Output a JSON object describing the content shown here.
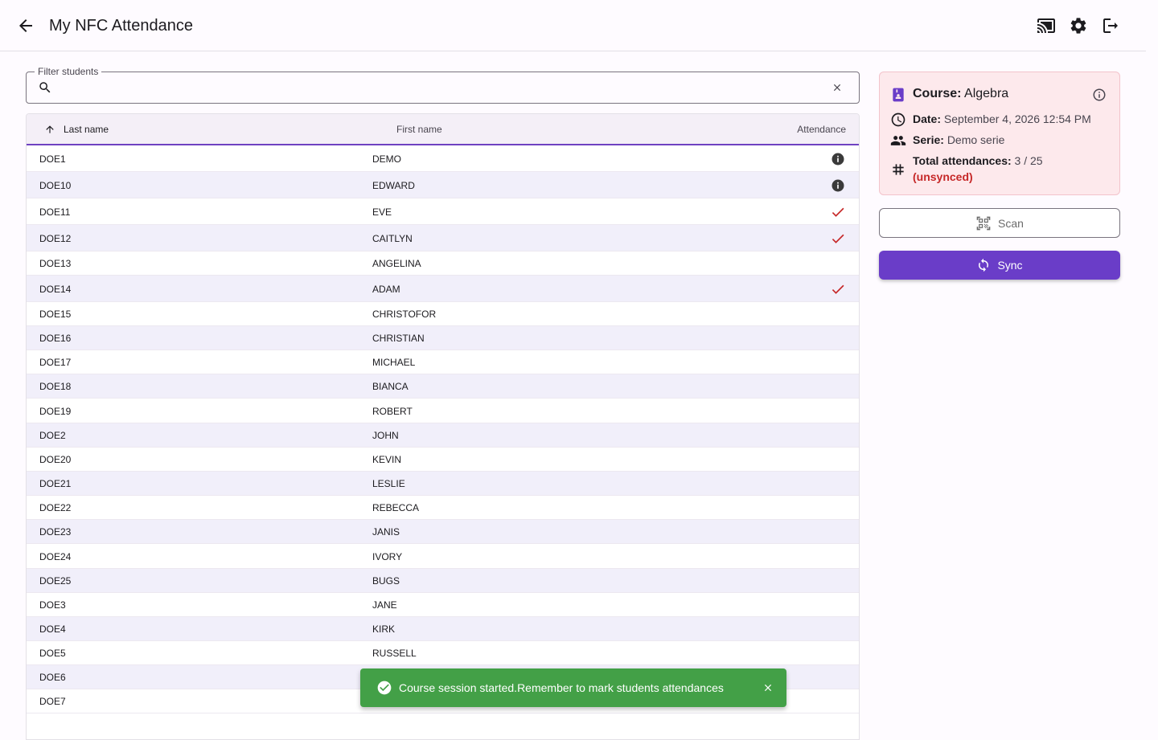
{
  "header": {
    "title": "My NFC Attendance",
    "icons": [
      "back-arrow-icon",
      "cast-icon",
      "settings-icon",
      "logout-icon"
    ]
  },
  "filter": {
    "label": "Filter students",
    "value": "",
    "placeholder": ""
  },
  "table": {
    "columns": {
      "last_name": "Last name",
      "first_name": "First name",
      "attendance": "Attendance"
    },
    "sort": "last_name ascending",
    "rows": [
      {
        "last": "DOE1",
        "first": "DEMO",
        "status": "info"
      },
      {
        "last": "DOE10",
        "first": "EDWARD",
        "status": "info"
      },
      {
        "last": "DOE11",
        "first": "EVE",
        "status": "check"
      },
      {
        "last": "DOE12",
        "first": "CAITLYN",
        "status": "check"
      },
      {
        "last": "DOE13",
        "first": "ANGELINA",
        "status": "none"
      },
      {
        "last": "DOE14",
        "first": "ADAM",
        "status": "check"
      },
      {
        "last": "DOE15",
        "first": "CHRISTOFOR",
        "status": "none"
      },
      {
        "last": "DOE16",
        "first": "CHRISTIAN",
        "status": "none"
      },
      {
        "last": "DOE17",
        "first": "MICHAEL",
        "status": "none"
      },
      {
        "last": "DOE18",
        "first": "BIANCA",
        "status": "none"
      },
      {
        "last": "DOE19",
        "first": "ROBERT",
        "status": "none"
      },
      {
        "last": "DOE2",
        "first": "JOHN",
        "status": "none"
      },
      {
        "last": "DOE20",
        "first": "KEVIN",
        "status": "none"
      },
      {
        "last": "DOE21",
        "first": "LESLIE",
        "status": "none"
      },
      {
        "last": "DOE22",
        "first": "REBECCA",
        "status": "none"
      },
      {
        "last": "DOE23",
        "first": "JANIS",
        "status": "none"
      },
      {
        "last": "DOE24",
        "first": "IVORY",
        "status": "none"
      },
      {
        "last": "DOE25",
        "first": "BUGS",
        "status": "none"
      },
      {
        "last": "DOE3",
        "first": "JANE",
        "status": "none"
      },
      {
        "last": "DOE4",
        "first": "KIRK",
        "status": "none"
      },
      {
        "last": "DOE5",
        "first": "RUSSELL",
        "status": "none"
      },
      {
        "last": "DOE6",
        "first": "",
        "status": "none"
      },
      {
        "last": "DOE7",
        "first": "",
        "status": "none"
      }
    ]
  },
  "course": {
    "course_label": "Course:",
    "course_value": "Algebra",
    "date_label": "Date:",
    "date_value": "September 4, 2026 12:54 PM",
    "serie_label": "Serie:",
    "serie_value": "Demo serie",
    "total_label": "Total attendances:",
    "total_value": "3 / 25",
    "unsynced": "(unsynced)"
  },
  "actions": {
    "scan_label": "Scan",
    "sync_label": "Sync"
  },
  "snackbar": {
    "message": "Course session started.Remember to mark students attendances"
  },
  "colors": {
    "accent": "#6a3dc8",
    "check": "#c62828",
    "snackbar": "#43a047",
    "card_bg": "#fde9ec"
  }
}
